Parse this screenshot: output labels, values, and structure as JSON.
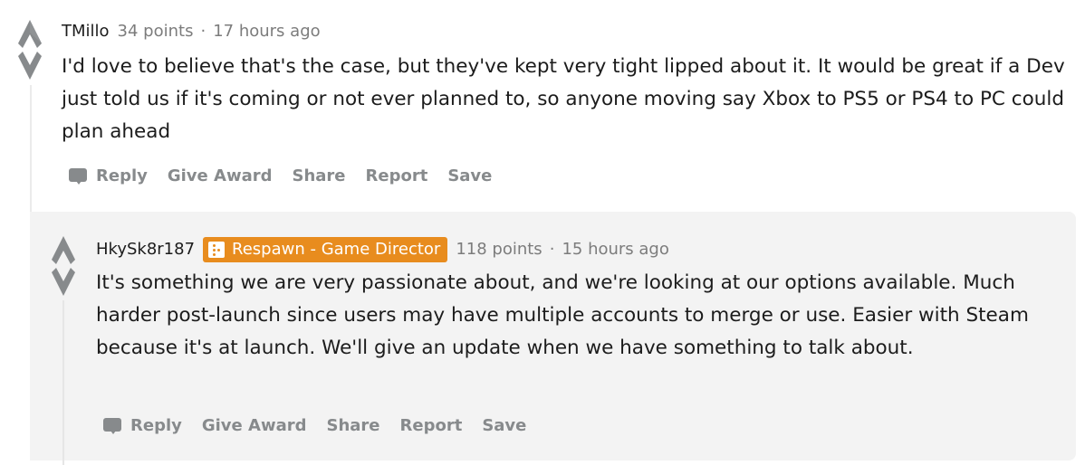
{
  "comments": [
    {
      "author": "TMillo",
      "points": "34 points",
      "separator": "·",
      "time": "17 hours ago",
      "body": "I'd love to believe that's the case, but they've kept very tight lipped about it. It would be great if a Dev just told us if it's coming or not ever planned to, so anyone moving say Xbox to PS5 or PS4 to PC could plan ahead",
      "actions": [
        "Reply",
        "Give Award",
        "Share",
        "Report",
        "Save"
      ]
    },
    {
      "author": "HkySk8r187",
      "flair": {
        "label": "Respawn - Game Director",
        "icon": "respawn-logo-icon",
        "color": "#e88c1e"
      },
      "points": "118 points",
      "separator": "·",
      "time": "15 hours ago",
      "body": "It's something we are very passionate about, and we're looking at our options available. Much harder post-launch since users may have multiple accounts to merge or use. Easier with Steam because it's at launch. We'll give an update when we have something to talk about.",
      "actions": [
        "Reply",
        "Give Award",
        "Share",
        "Report",
        "Save"
      ]
    }
  ],
  "icons": {
    "upvote": "upvote-arrow-icon",
    "downvote": "downvote-arrow-icon",
    "reply": "comment-bubble-icon"
  },
  "colors": {
    "vote_gray": "#878a8c",
    "muted_text": "#7c7c7c",
    "child_bg": "#f3f3f3",
    "flair_bg": "#e88c1e"
  }
}
